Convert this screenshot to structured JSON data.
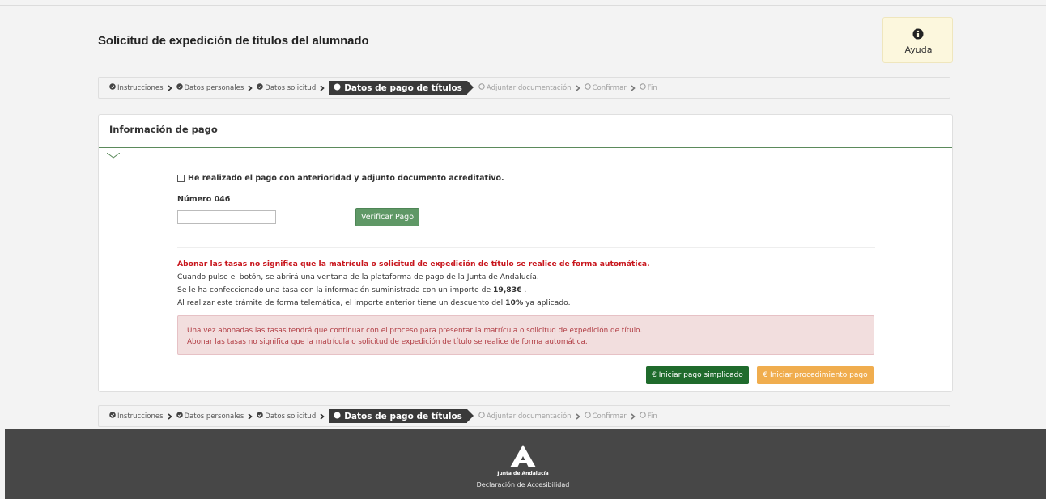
{
  "page": {
    "title": "Solicitud de expedición de títulos del alumnado"
  },
  "help": {
    "label": "Ayuda",
    "icon": "info-icon"
  },
  "steps": [
    {
      "label": "Instrucciones",
      "state": "done"
    },
    {
      "label": "Datos personales",
      "state": "done"
    },
    {
      "label": "Datos solicitud",
      "state": "done"
    },
    {
      "label": "Datos de pago de títulos",
      "state": "active"
    },
    {
      "label": "Adjuntar documentación",
      "state": "todo"
    },
    {
      "label": "Confirmar",
      "state": "todo"
    },
    {
      "label": "Fin",
      "state": "todo"
    }
  ],
  "panel": {
    "title": "Información de pago",
    "checkbox_label": "He realizado el pago con anterioridad y adjunto documento acreditativo.",
    "numero_label": "Número 046",
    "numero_value": "",
    "verify_label": "Verificar Pago",
    "warning": "Abonar las tasas no significa que la matrícula o solicitud de expedición de título se realice de forma automática.",
    "info_line1": "Cuando pulse el botón, se abrirá una ventana de la plataforma de pago de la Junta de Andalucía.",
    "info_line2_pre": "Se le ha confeccionado una tasa con la información suministrada con un importe de ",
    "info_line2_amount": "19,83€",
    "info_line2_post": " .",
    "info_line3_pre": "Al realizar este trámite de forma telemática, el importe anterior tiene un descuento del ",
    "info_line3_pct": "10%",
    "info_line3_post": " ya aplicado.",
    "alert_line1": "Una vez abonadas las tasas tendrá que continuar con el proceso para presentar la matrícula o solicitud de expedición de título.",
    "alert_line2": "Abonar las tasas no significa que la matrícula o solicitud de expedición de título se realice de forma automática.",
    "btn_simple": "€ Iniciar pago simplicado",
    "btn_proc": "€ Iniciar procedimiento pago"
  },
  "footer": {
    "org": "Junta de Andalucía",
    "accessibility": "Declaración de Accesibilidad"
  },
  "colors": {
    "accent_green": "#1f6b2c",
    "verify_green": "#5f9866",
    "warning_red": "#c8161d",
    "orange": "#f0ad4e",
    "footer": "#474747"
  }
}
